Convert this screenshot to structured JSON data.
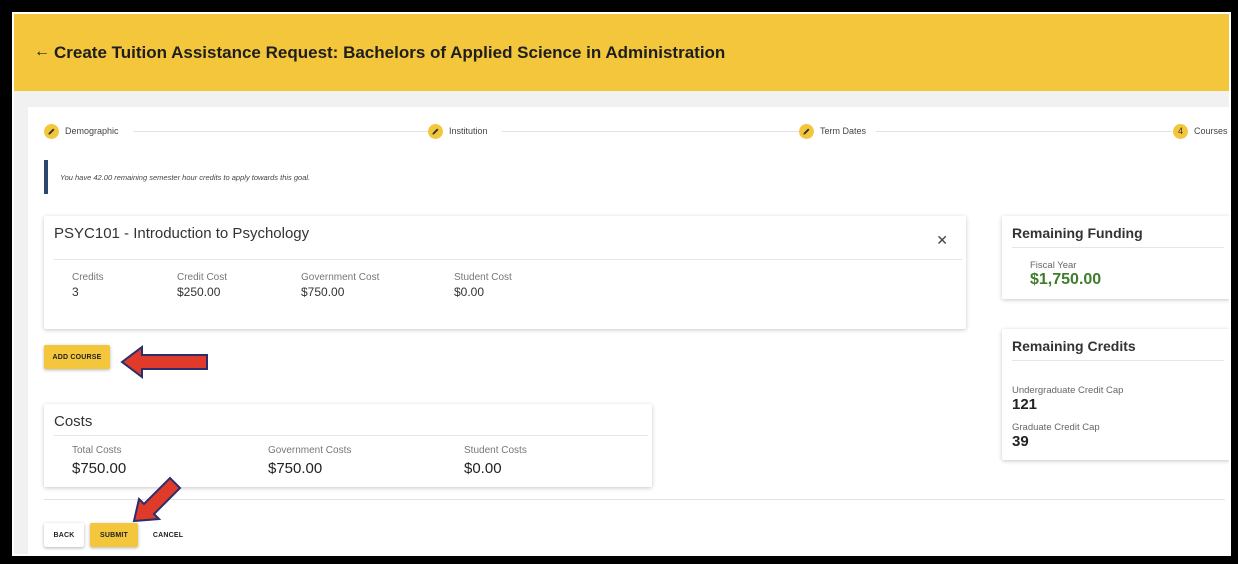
{
  "header": {
    "back_icon": "arrow-left-icon",
    "title": "Create Tuition Assistance Request: Bachelors of Applied Science in Administration"
  },
  "stepper": {
    "steps": [
      {
        "label": "Demographic",
        "icon": "pencil-icon"
      },
      {
        "label": "Institution",
        "icon": "pencil-icon"
      },
      {
        "label": "Term Dates",
        "icon": "pencil-icon"
      },
      {
        "label": "Courses",
        "number": "4"
      }
    ]
  },
  "alert": {
    "text": "You have 42.00 remaining semester hour credits to apply towards this goal."
  },
  "course": {
    "title": "PSYC101 - Introduction to Psychology",
    "close_icon": "close-icon",
    "fields": [
      {
        "label": "Credits",
        "value": "3"
      },
      {
        "label": "Credit Cost",
        "value": "$250.00"
      },
      {
        "label": "Government Cost",
        "value": "$750.00"
      },
      {
        "label": "Student Cost",
        "value": "$0.00"
      }
    ]
  },
  "buttons": {
    "add_course": "ADD COURSE",
    "back": "BACK",
    "submit": "SUBMIT",
    "cancel": "CANCEL"
  },
  "costs": {
    "heading": "Costs",
    "items": [
      {
        "label": "Total Costs",
        "value": "$750.00"
      },
      {
        "label": "Government Costs",
        "value": "$750.00"
      },
      {
        "label": "Student Costs",
        "value": "$0.00"
      }
    ]
  },
  "remaining_funding": {
    "heading": "Remaining Funding",
    "fiscal_year_label": "Fiscal Year",
    "fiscal_year_value": "$1,750.00"
  },
  "remaining_credits": {
    "heading": "Remaining Credits",
    "undergrad_label": "Undergraduate Credit Cap",
    "undergrad_value": "121",
    "grad_label": "Graduate Credit Cap",
    "grad_value": "39"
  },
  "colors": {
    "header": "#f4c63c",
    "accent": "#f4c63c",
    "funding_green": "#3e7d2b",
    "alert_border": "#2c4770",
    "annotation_arrow": "#e03a2a"
  }
}
